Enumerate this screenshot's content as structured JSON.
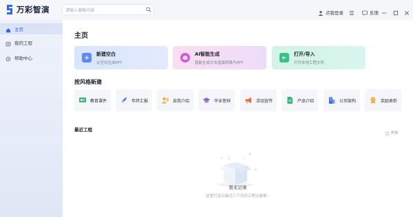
{
  "app": {
    "name": "万彩智演"
  },
  "search": {
    "placeholder": "请输入搜索内容"
  },
  "topbar": {
    "login_label": "点我登录",
    "feedback_label": "反馈"
  },
  "sidebar": {
    "items": [
      {
        "label": "主页",
        "icon": "home-icon",
        "active": true
      },
      {
        "label": "我的工程",
        "icon": "folder-icon",
        "active": false
      },
      {
        "label": "帮助中心",
        "icon": "help-icon",
        "active": false
      }
    ]
  },
  "main": {
    "title": "主页",
    "quick_actions": [
      {
        "title": "新建空白",
        "subtitle": "从空白生成PPT",
        "icon": "plus-icon",
        "accent": "#5b8cf5"
      },
      {
        "title": "AI智能生成",
        "subtitle": "智能生成文本直接转换为PPT",
        "icon": "ai-robot-icon",
        "accent": "#d55bd6"
      },
      {
        "title": "打开/导入",
        "subtitle": "打开本地工程文件",
        "icon": "import-arrow-icon",
        "accent": "#37c28a"
      }
    ],
    "style_section_title": "按风格新建",
    "styles": [
      {
        "label": "教育课件",
        "icon": "presentation-icon",
        "color": "#2eb872"
      },
      {
        "label": "年终汇报",
        "icon": "feather-icon",
        "color": "#3b6fe0"
      },
      {
        "label": "自我介绍",
        "icon": "person-card-icon",
        "color": "#f0a43a"
      },
      {
        "label": "毕业答辩",
        "icon": "graduation-cap-icon",
        "color": "#8a63d2"
      },
      {
        "label": "活动宣传",
        "icon": "megaphone-icon",
        "color": "#f06b3a"
      },
      {
        "label": "产品介绍",
        "icon": "document-icon",
        "color": "#2eb872"
      },
      {
        "label": "公司架构",
        "icon": "building-icon",
        "color": "#3b6fe0"
      },
      {
        "label": "奖励表彰",
        "icon": "award-icon",
        "color": "#f0a43a"
      }
    ],
    "recent_title": "最近工程",
    "refresh_label": "刷新",
    "empty": {
      "title": "暂无记录",
      "subtitle": "这里只显示最近三个月的工程记录哦~"
    }
  }
}
